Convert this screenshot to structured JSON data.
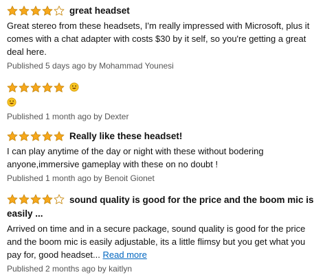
{
  "reviews": [
    {
      "rating": 4,
      "title": "great headset",
      "body": "Great stereo from these headsets, I'm really impressed with Microsoft, plus it comes with a chat adapter with costs $30 by it self, so you're getting a great deal here.",
      "meta": "Published 5 days ago by Mohammad Younesi"
    },
    {
      "rating": 5,
      "title_emoji": "smiley-face-icon",
      "body_emoji": "smiley-face-icon",
      "meta": "Published 1 month ago by Dexter"
    },
    {
      "rating": 5,
      "title": "Really like these headset!",
      "body": "I can play anytime of the day or night with these without bodering anyone,immersive gameplay with these on no doubt !",
      "meta": "Published 1 month ago by Benoit Gionet"
    },
    {
      "rating": 4,
      "title": "sound quality is good for the price and the boom mic is easily ...",
      "body": "Arrived on time and in a secure package, sound quality is good for the price and the boom mic is easily adjustable, its a little flimsy but you get what you pay for, good headset...",
      "read_more": "Read more",
      "meta": "Published 2 months ago by kaitlyn"
    }
  ],
  "colors": {
    "star_fill": "#f7a81b",
    "star_stroke": "#c98a12",
    "star_empty": "#ffffff",
    "link": "#0066c0",
    "meta": "#555555"
  },
  "icons": {
    "star": "star-icon",
    "emoji": "smiley-face-icon"
  }
}
